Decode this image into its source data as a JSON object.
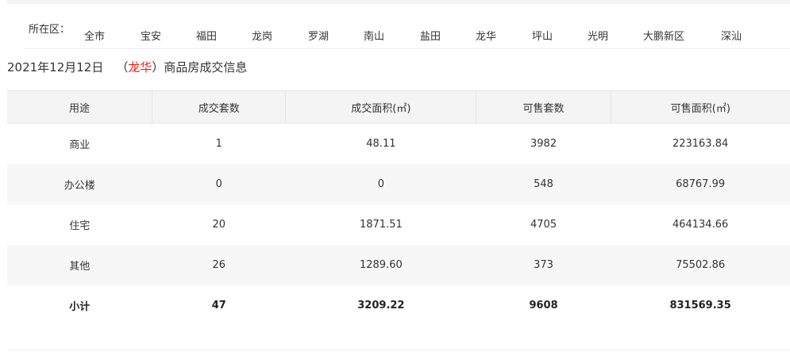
{
  "filter": {
    "label": "所在区：",
    "districts": [
      "全市",
      "宝安",
      "福田",
      "龙岗",
      "罗湖",
      "南山",
      "盐田",
      "龙华",
      "坪山",
      "光明",
      "大鹏新区",
      "深汕"
    ]
  },
  "heading": {
    "date": "2021年12月12日",
    "open_paren": "（",
    "district": "龙华",
    "close_paren": "）",
    "suffix": "商品房成交信息"
  },
  "table": {
    "headers": [
      "用途",
      "成交套数",
      "成交面积(㎡)",
      "可售套数",
      "可售面积(㎡)"
    ],
    "rows": [
      [
        "商业",
        "1",
        "48.11",
        "3982",
        "223163.84"
      ],
      [
        "办公楼",
        "0",
        "0",
        "548",
        "68767.99"
      ],
      [
        "住宅",
        "20",
        "1871.51",
        "4705",
        "464134.66"
      ],
      [
        "其他",
        "26",
        "1289.60",
        "373",
        "75502.86"
      ],
      [
        "小计",
        "47",
        "3209.22",
        "9608",
        "831569.35"
      ]
    ]
  },
  "colors": {
    "accent": "#e0231a",
    "header_bg": "#f4f4f4",
    "alt_row_bg": "#f7f7f7"
  }
}
